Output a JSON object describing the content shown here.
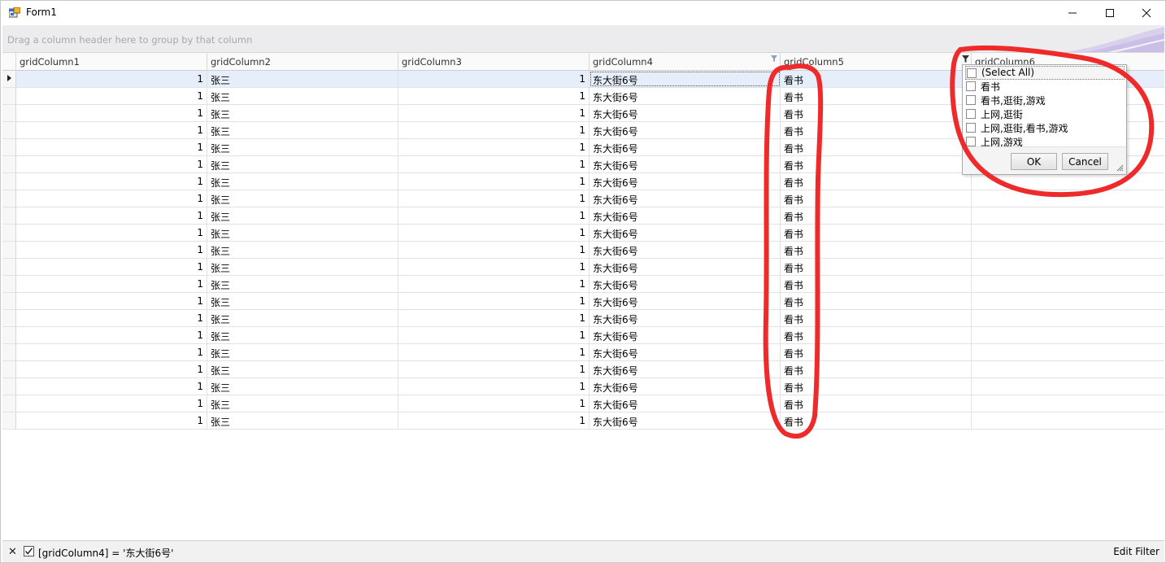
{
  "window": {
    "title": "Form1"
  },
  "icons": {
    "app": "form-app-icon",
    "minimize": "minimize-icon",
    "maximize": "maximize-icon",
    "close": "close-icon",
    "filter": "filter-funnel-icon",
    "row_indicator": "row-pointer-icon"
  },
  "grid": {
    "group_panel_text": "Drag a column header here to group by that column",
    "columns": [
      "gridColumn1",
      "gridColumn2",
      "gridColumn3",
      "gridColumn4",
      "gridColumn5",
      "gridColumn6"
    ],
    "rows": [
      [
        "1",
        "张三",
        "1",
        "东大街6号",
        "看书",
        ""
      ],
      [
        "1",
        "张三",
        "1",
        "东大街6号",
        "看书",
        ""
      ],
      [
        "1",
        "张三",
        "1",
        "东大街6号",
        "看书",
        ""
      ],
      [
        "1",
        "张三",
        "1",
        "东大街6号",
        "看书",
        ""
      ],
      [
        "1",
        "张三",
        "1",
        "东大街6号",
        "看书",
        ""
      ],
      [
        "1",
        "张三",
        "1",
        "东大街6号",
        "看书",
        ""
      ],
      [
        "1",
        "张三",
        "1",
        "东大街6号",
        "看书",
        ""
      ],
      [
        "1",
        "张三",
        "1",
        "东大街6号",
        "看书",
        ""
      ],
      [
        "1",
        "张三",
        "1",
        "东大街6号",
        "看书",
        ""
      ],
      [
        "1",
        "张三",
        "1",
        "东大街6号",
        "看书",
        ""
      ],
      [
        "1",
        "张三",
        "1",
        "东大街6号",
        "看书",
        ""
      ],
      [
        "1",
        "张三",
        "1",
        "东大街6号",
        "看书",
        ""
      ],
      [
        "1",
        "张三",
        "1",
        "东大街6号",
        "看书",
        ""
      ],
      [
        "1",
        "张三",
        "1",
        "东大街6号",
        "看书",
        ""
      ],
      [
        "1",
        "张三",
        "1",
        "东大街6号",
        "看书",
        ""
      ],
      [
        "1",
        "张三",
        "1",
        "东大街6号",
        "看书",
        ""
      ],
      [
        "1",
        "张三",
        "1",
        "东大街6号",
        "看书",
        ""
      ],
      [
        "1",
        "张三",
        "1",
        "东大街6号",
        "看书",
        ""
      ],
      [
        "1",
        "张三",
        "1",
        "东大街6号",
        "看书",
        ""
      ],
      [
        "1",
        "张三",
        "1",
        "东大街6号",
        "看书",
        ""
      ],
      [
        "1",
        "张三",
        "1",
        "东大街6号",
        "看书",
        ""
      ]
    ]
  },
  "filter_popup": {
    "items": [
      "(Select All)",
      "看书",
      "看书,逛街,游戏",
      "上网,逛街",
      "上网,逛街,看书,游戏",
      "上网,游戏"
    ],
    "ok_label": "OK",
    "cancel_label": "Cancel"
  },
  "filter_panel": {
    "expression": "[gridColumn4] = '东大街6号'",
    "enabled": true,
    "edit_label": "Edit Filter"
  },
  "colors": {
    "annotation": "#ee2a2a",
    "focused_row": "#e6eefb",
    "group_panel": "#ececee"
  }
}
